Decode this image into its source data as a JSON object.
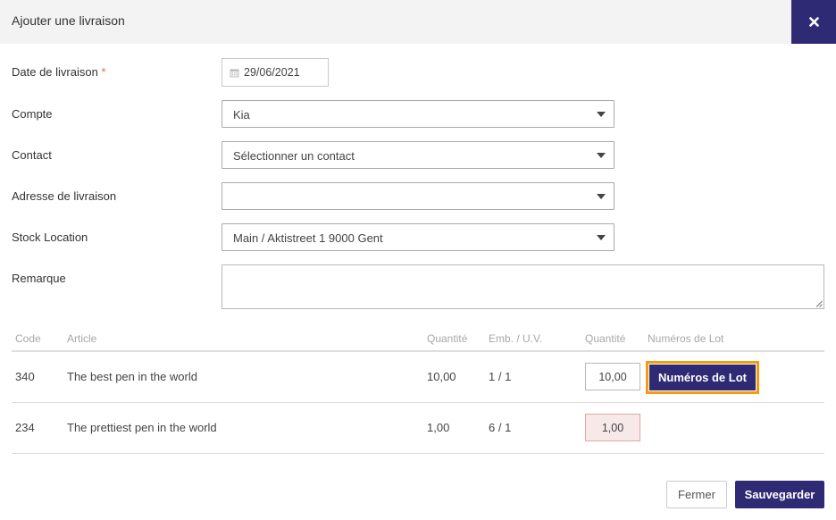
{
  "modal": {
    "title": "Ajouter une livraison",
    "close_icon": "close-icon"
  },
  "form": {
    "delivery_date": {
      "label": "Date de livraison",
      "required_mark": "*",
      "value": "29/06/2021",
      "icon": "calendar-icon"
    },
    "account": {
      "label": "Compte",
      "value": "Kia"
    },
    "contact": {
      "label": "Contact",
      "value": "Sélectionner un contact"
    },
    "delivery_address": {
      "label": "Adresse de livraison",
      "value": ""
    },
    "stock_location": {
      "label": "Stock Location",
      "value": "Main / Aktistreet 1 9000 Gent"
    },
    "remark": {
      "label": "Remarque",
      "value": ""
    }
  },
  "table": {
    "headers": {
      "code": "Code",
      "article": "Article",
      "quantity": "Quantité",
      "packaging": "Emb. / U.V.",
      "quantity_input": "Quantité",
      "lot_numbers": "Numéros de Lot"
    },
    "rows": [
      {
        "code": "340",
        "article": "The best pen in the world",
        "quantity": "10,00",
        "packaging": "1 / 1",
        "quantity_input": "10,00",
        "lot_button": "Numéros de Lot",
        "error": false
      },
      {
        "code": "234",
        "article": "The prettiest pen in the world",
        "quantity": "1,00",
        "packaging": "6 / 1",
        "quantity_input": "1,00",
        "lot_button": "",
        "error": true
      }
    ]
  },
  "footer": {
    "close_label": "Fermer",
    "save_label": "Sauvegarder"
  },
  "colors": {
    "primary": "#2e2a73",
    "highlight": "#f39c12",
    "required": "#e0645a",
    "error_bg": "#f6e9e8"
  }
}
